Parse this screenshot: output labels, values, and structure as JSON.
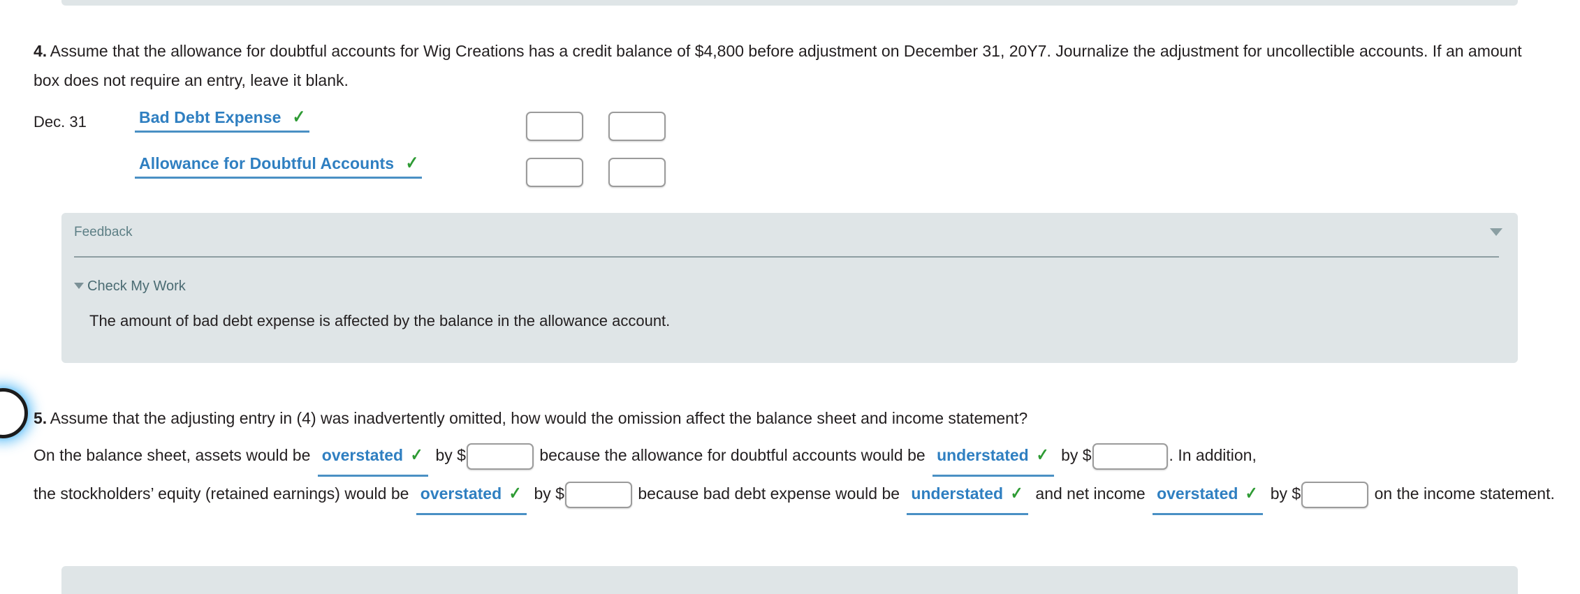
{
  "colors": {
    "link_blue": "#2f7fc1",
    "underline_blue": "#4a90c4",
    "check_green": "#2e9b34",
    "feedback_bg": "#dfe5e7",
    "feedback_label": "#5d7f85",
    "text": "#231f20"
  },
  "question4": {
    "number": "4.",
    "text": "Assume that the allowance for doubtful accounts for Wig Creations has a credit balance of $4,800 before adjustment on December 31, 20Y7. Journalize the adjustment for uncollectible accounts. If an amount box does not require an entry, leave it blank.",
    "journal": {
      "date": "Dec. 31",
      "rows": [
        {
          "account": "Bad Debt Expense",
          "status_icon": "check-icon",
          "debit_value": "",
          "credit_value": ""
        },
        {
          "account": "Allowance for Doubtful Accounts",
          "status_icon": "check-icon",
          "debit_value": "",
          "credit_value": ""
        }
      ]
    },
    "feedback": {
      "title": "Feedback",
      "collapse_icon": "triangle-down-icon",
      "check_my_work_label": "Check My Work",
      "check_my_work_icon": "triangle-down-icon",
      "body": "The amount of bad debt expense is affected by the balance in the allowance account."
    }
  },
  "question5": {
    "number": "5.",
    "text": "Assume that the adjusting entry in (4) was inadvertently omitted, how would the omission affect the balance sheet and income statement?",
    "answer_segments": [
      {
        "type": "text",
        "value": "On the balance sheet, assets would be"
      },
      {
        "type": "dropdown",
        "value": "overstated",
        "status_icon": "check-icon"
      },
      {
        "type": "text",
        "value": "by $"
      },
      {
        "type": "input",
        "value": ""
      },
      {
        "type": "text",
        "value": "because the allowance for doubtful accounts would be"
      },
      {
        "type": "dropdown",
        "value": "understated",
        "status_icon": "check-icon"
      },
      {
        "type": "text",
        "value": "by $"
      },
      {
        "type": "input",
        "value": ""
      },
      {
        "type": "text",
        "value": ". In addition,"
      },
      {
        "type": "text",
        "value": "the stockholders’ equity (retained earnings) would be"
      },
      {
        "type": "dropdown",
        "value": "overstated",
        "status_icon": "check-icon"
      },
      {
        "type": "text",
        "value": "by $"
      },
      {
        "type": "input",
        "value": ""
      },
      {
        "type": "text",
        "value": "because bad debt expense would be"
      },
      {
        "type": "dropdown",
        "value": "understated",
        "status_icon": "check-icon"
      },
      {
        "type": "text",
        "value": "and net income"
      },
      {
        "type": "dropdown",
        "value": "overstated",
        "status_icon": "check-icon"
      },
      {
        "type": "text",
        "value": "by $"
      },
      {
        "type": "input",
        "value": ""
      },
      {
        "type": "text",
        "value": "on the income statement."
      }
    ]
  }
}
